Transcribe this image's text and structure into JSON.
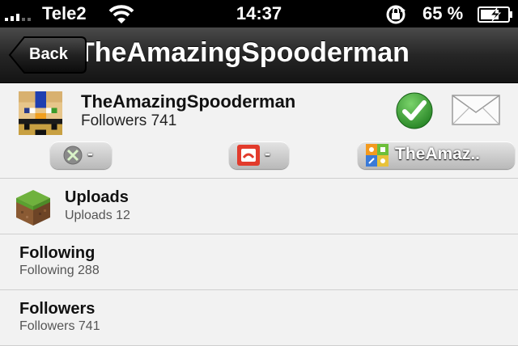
{
  "status_bar": {
    "carrier": "Tele2",
    "time": "14:37",
    "battery_percent": "65 %",
    "icons": [
      "signal-icon",
      "wifi-icon",
      "rotation-lock-icon",
      "battery-charging-icon"
    ]
  },
  "nav": {
    "back_label": "Back",
    "title": "TheAmazingSpooderman"
  },
  "profile": {
    "name": "TheAmazingSpooderman",
    "followers": "Followers 741",
    "accounts": {
      "xbox": "-",
      "minecraft": "-",
      "game_center": "TheAmaz.."
    }
  },
  "list": {
    "uploads": {
      "title": "Uploads",
      "subtitle": "Uploads 12"
    },
    "following": {
      "title": "Following",
      "subtitle": "Following 288"
    },
    "followers": {
      "title": "Followers",
      "subtitle": "Followers 741"
    }
  },
  "colors": {
    "nav_bar": "#262626",
    "check_green": "#2c9a2c",
    "background": "#f2f2f2"
  }
}
